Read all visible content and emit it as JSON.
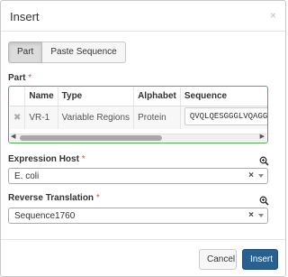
{
  "dialog": {
    "title": "Insert",
    "close_glyph": "×"
  },
  "tabs": [
    {
      "label": "Part",
      "active": true
    },
    {
      "label": "Paste Sequence",
      "active": false
    }
  ],
  "part": {
    "label": "Part",
    "required_mark": "*",
    "columns": [
      "Name",
      "Type",
      "Alphabet",
      "Sequence"
    ],
    "rows": [
      {
        "remove_glyph": "✖",
        "name": "VR-1",
        "type": "Variable Regions",
        "alphabet": "Protein",
        "sequence": "QVQLQESGGGLVQAGGSLRL"
      }
    ],
    "scroll_left_glyph": "◀",
    "scroll_right_glyph": "▶"
  },
  "expression_host": {
    "label": "Expression Host",
    "required_mark": "*",
    "value": "E. coli",
    "clear_glyph": "×"
  },
  "reverse_translation": {
    "label": "Reverse Translation",
    "required_mark": "*",
    "value": "Sequence1760",
    "clear_glyph": "×"
  },
  "footer": {
    "cancel_label": "Cancel",
    "insert_label": "Insert"
  },
  "colors": {
    "primary": "#286090",
    "valid_border": "#4cae4c",
    "required": "#d9534f"
  },
  "icons": [
    "zoom-in-icon",
    "remove-row-icon",
    "dropdown-caret-icon"
  ]
}
